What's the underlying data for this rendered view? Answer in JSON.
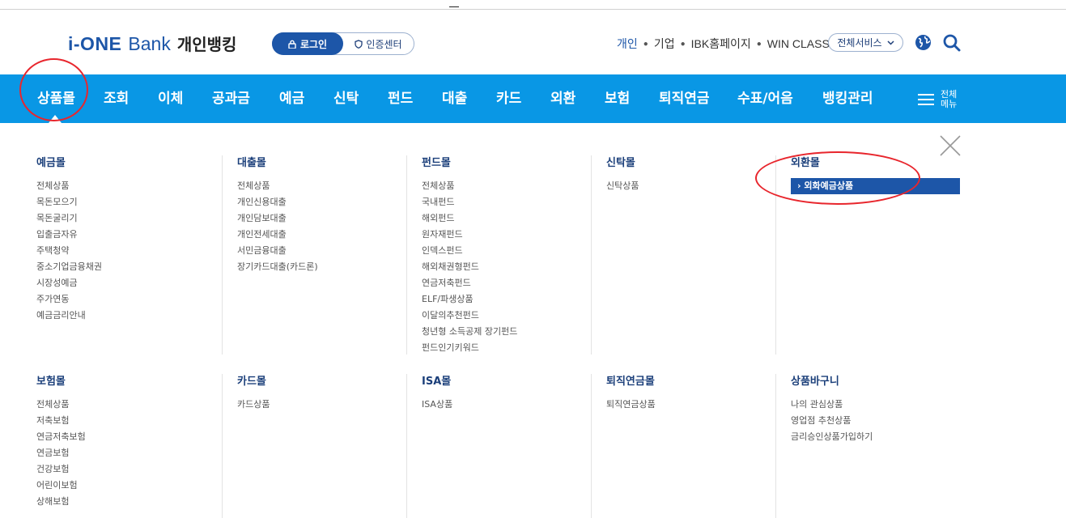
{
  "logo": {
    "brand_prefix": "i-ONE",
    "brand_bank": "Bank",
    "brand_ko": "개인뱅킹"
  },
  "auth": {
    "login_label": "로그인",
    "cert_label": "인증센터"
  },
  "quick_links": [
    "개인",
    "기업",
    "IBK홈페이지",
    "WIN CLASS"
  ],
  "all_services_label": "전체서비스",
  "gnb": {
    "items": [
      "상품몰",
      "조회",
      "이체",
      "공과금",
      "예금",
      "신탁",
      "펀드",
      "대출",
      "카드",
      "외환",
      "보험",
      "퇴직연금",
      "수표/어음",
      "뱅킹관리"
    ],
    "all_menu_label": "전체\n메뉴"
  },
  "mega_menu": [
    {
      "title": "예금몰",
      "items": [
        "전체상품",
        "목돈모으기",
        "목돈굴리기",
        "입출금자유",
        "주택청약",
        "중소기업금융채권",
        "시장성예금",
        "주가연동",
        "예금금리안내"
      ]
    },
    {
      "title": "대출몰",
      "items": [
        "전체상품",
        "개인신용대출",
        "개인담보대출",
        "개인전세대출",
        "서민금융대출",
        "장기카드대출(카드론)"
      ]
    },
    {
      "title": "펀드몰",
      "items": [
        "전체상품",
        "국내펀드",
        "해외펀드",
        "원자재펀드",
        "인덱스펀드",
        "해외채권형펀드",
        "연금저축펀드",
        "ELF/파생상품",
        "이달의추천펀드",
        "청년형 소득공제 장기펀드",
        "펀드인기키워드"
      ]
    },
    {
      "title": "신탁몰",
      "items": [
        "신탁상품"
      ]
    },
    {
      "title": "외환몰",
      "items": [
        "외화예금상품"
      ]
    },
    {
      "title": "보험몰",
      "items": [
        "전체상품",
        "저축보험",
        "연금저축보험",
        "연금보험",
        "건강보험",
        "어린이보험",
        "상해보험"
      ]
    },
    {
      "title": "카드몰",
      "items": [
        "카드상품"
      ]
    },
    {
      "title": "ISA몰",
      "items": [
        "ISA상품"
      ]
    },
    {
      "title": "퇴직연금몰",
      "items": [
        "퇴직연금상품"
      ]
    },
    {
      "title": "상품바구니",
      "items": [
        "나의 관심상품",
        "영업점 추천상품",
        "금리승인상품가입하기"
      ]
    }
  ],
  "colors": {
    "brand_blue": "#1d56a8",
    "gnb_bg": "#0997e5",
    "annotation_red": "#e8262d"
  }
}
